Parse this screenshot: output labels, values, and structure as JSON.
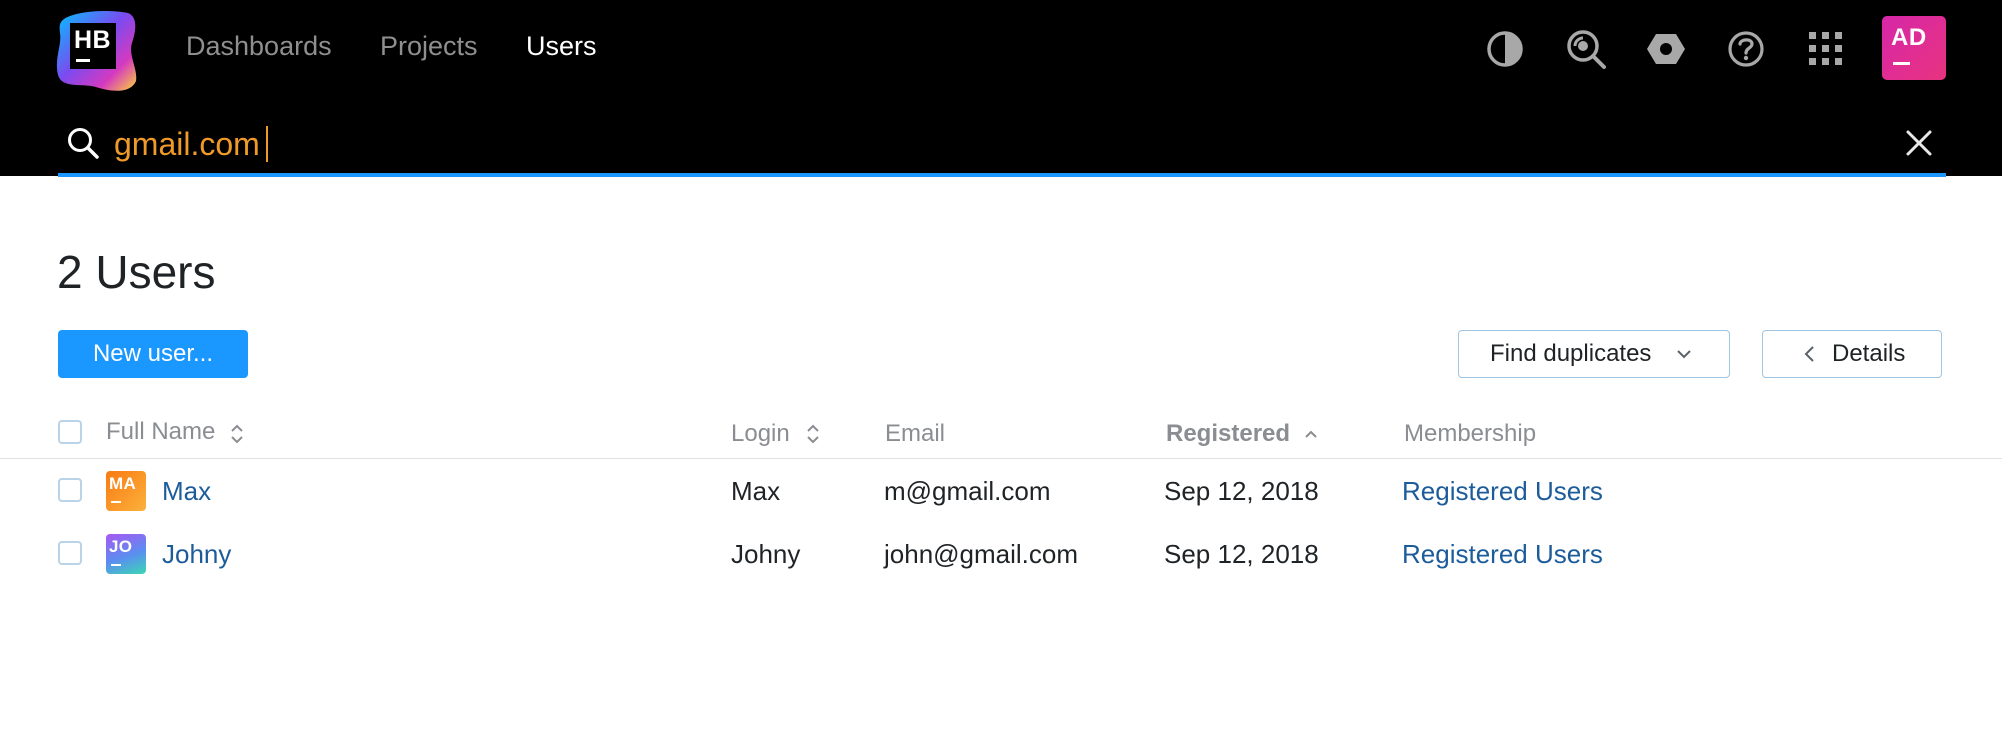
{
  "header": {
    "logo_text": "HB",
    "nav": [
      {
        "label": "Dashboards",
        "active": false
      },
      {
        "label": "Projects",
        "active": false
      },
      {
        "label": "Users",
        "active": true
      }
    ],
    "icons": [
      "theme-contrast-icon",
      "global-search-icon",
      "settings-icon",
      "help-icon",
      "apps-grid-icon"
    ],
    "user_avatar_initials": "AD"
  },
  "search": {
    "value": "gmail.com",
    "placeholder": ""
  },
  "page": {
    "title": "2 Users",
    "new_user_label": "New user...",
    "find_duplicates_label": "Find duplicates",
    "details_label": "Details"
  },
  "table": {
    "columns": {
      "full_name": "Full Name",
      "login": "Login",
      "email": "Email",
      "registered": "Registered",
      "membership": "Membership"
    },
    "sorted_by": "Registered",
    "rows": [
      {
        "initials": "MA",
        "full_name": "Max",
        "login": "Max",
        "email": "m@gmail.com",
        "registered": "Sep 12, 2018",
        "membership": "Registered Users"
      },
      {
        "initials": "JO",
        "full_name": "Johny",
        "login": "Johny",
        "email": "john@gmail.com",
        "registered": "Sep 12, 2018",
        "membership": "Registered Users"
      }
    ]
  },
  "colors": {
    "header_bg": "#000000",
    "accent_blue": "#1a98ff",
    "search_text": "#f09a29",
    "link": "#1d5c9a"
  }
}
